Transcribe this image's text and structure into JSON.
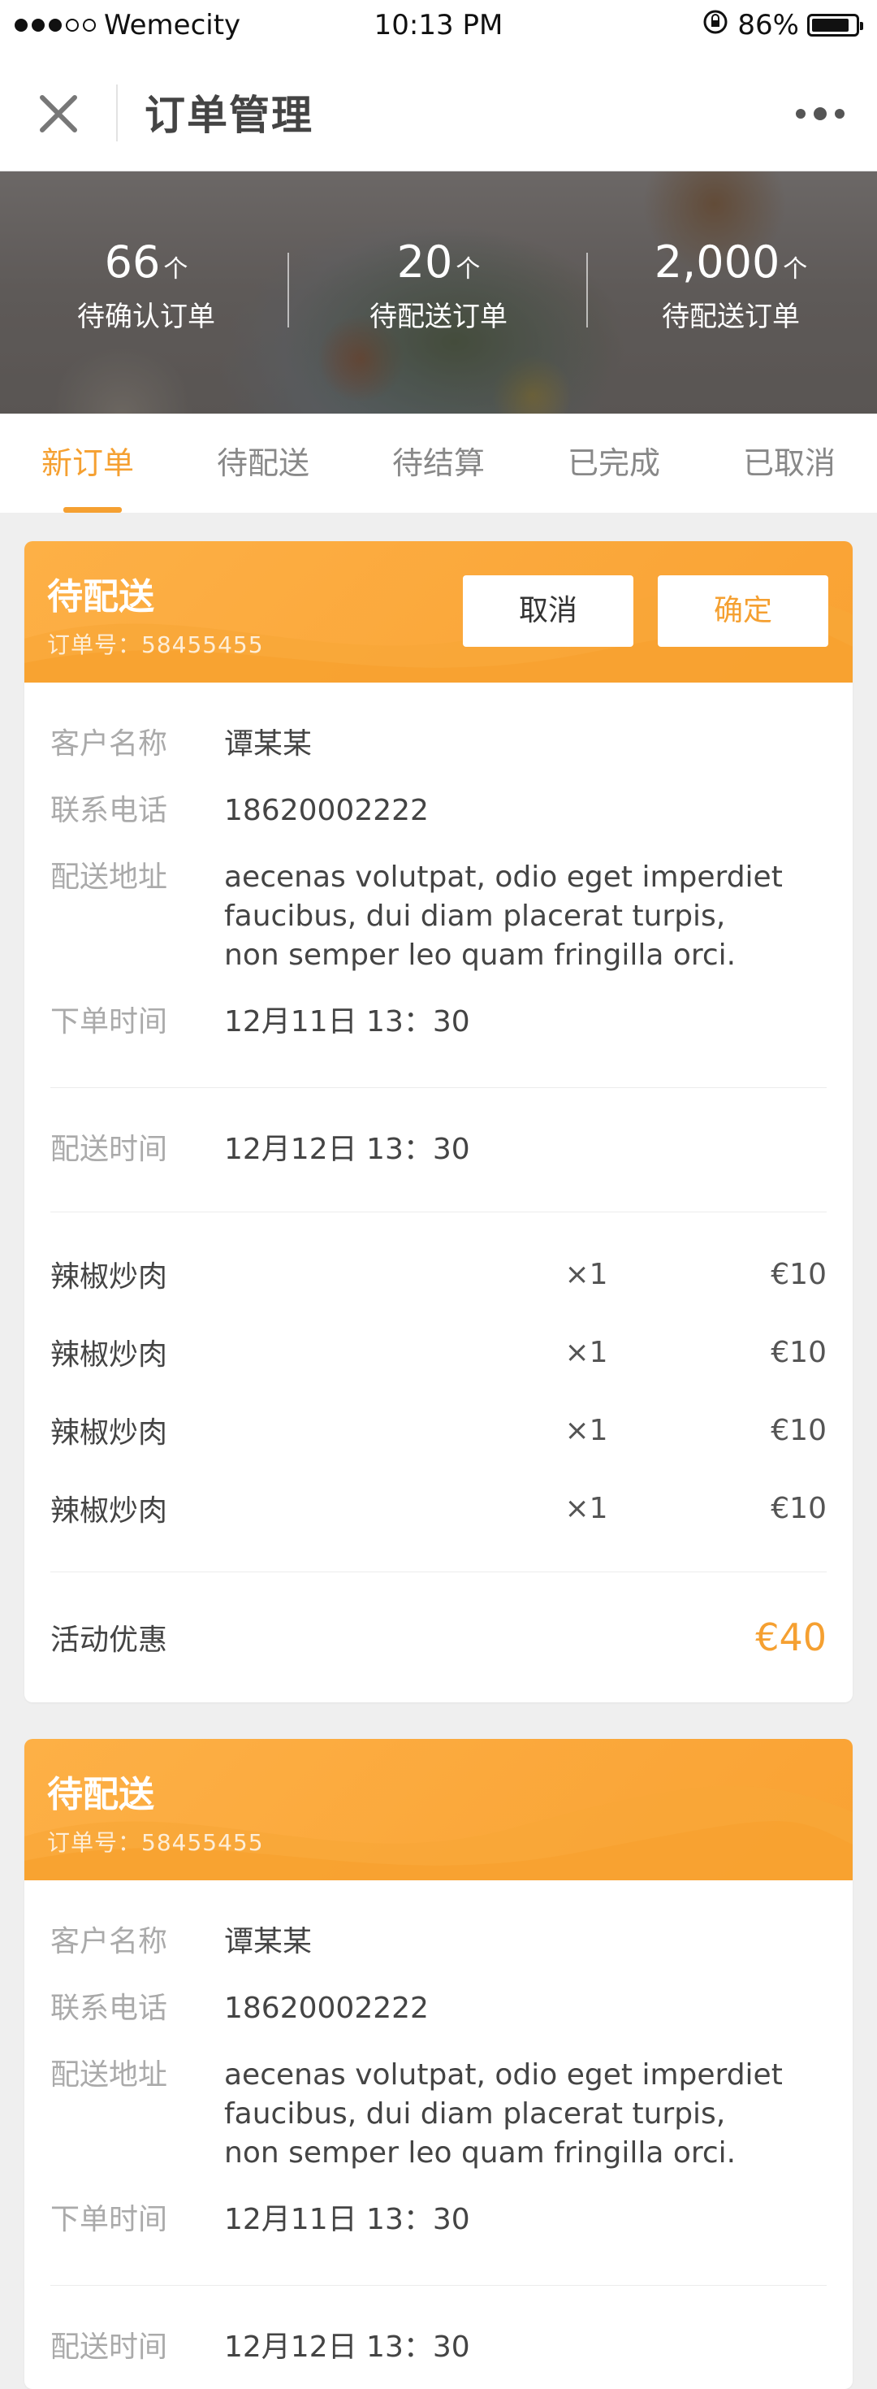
{
  "status_bar": {
    "carrier": "Wemecity",
    "time": "10:13 PM",
    "battery": "86%"
  },
  "nav": {
    "title": "订单管理"
  },
  "stats": [
    {
      "value": "66",
      "unit": "个",
      "label": "待确认订单"
    },
    {
      "value": "20",
      "unit": "个",
      "label": "待配送订单"
    },
    {
      "value": "2,000",
      "unit": "个",
      "label": "待配送订单"
    }
  ],
  "tabs": [
    {
      "label": "新订单"
    },
    {
      "label": "待配送"
    },
    {
      "label": "待结算"
    },
    {
      "label": "已完成"
    },
    {
      "label": "已取消"
    }
  ],
  "orders": [
    {
      "status": "待配送",
      "order_no": "订单号：58455455",
      "cancel_label": "取消",
      "confirm_label": "确定",
      "customer_label": "客户名称",
      "customer": "谭某某",
      "phone_label": "联系电话",
      "phone": "18620002222",
      "address_label": "配送地址",
      "address": "aecenas volutpat, odio eget imperdiet faucibus, dui diam placerat turpis, non semper leo quam fringilla orci.",
      "order_time_label": "下单时间",
      "order_time": "12月11日 13：30",
      "delivery_time_label": "配送时间",
      "delivery_time": "12月12日 13：30",
      "items": [
        {
          "name": "辣椒炒肉",
          "qty": "×1",
          "price": "€10"
        },
        {
          "name": "辣椒炒肉",
          "qty": "×1",
          "price": "€10"
        },
        {
          "name": "辣椒炒肉",
          "qty": "×1",
          "price": "€10"
        },
        {
          "name": "辣椒炒肉",
          "qty": "×1",
          "price": "€10"
        }
      ],
      "promo_label": "活动优惠",
      "promo_value": "€40"
    },
    {
      "status": "待配送",
      "order_no": "订单号：58455455",
      "customer_label": "客户名称",
      "customer": "谭某某",
      "phone_label": "联系电话",
      "phone": "18620002222",
      "address_label": "配送地址",
      "address": "aecenas volutpat, odio eget imperdiet faucibus, dui diam placerat turpis, non semper leo quam fringilla orci.",
      "order_time_label": "下单时间",
      "order_time": "12月11日 13：30",
      "delivery_time_label": "配送时间",
      "delivery_time": "12月12日 13：30"
    }
  ],
  "icons": {
    "close": "close-icon",
    "more": "more-icon",
    "lock_rotation": "lock-rotation-icon"
  },
  "colors": {
    "accent": "#f5a031",
    "card_header": "#fdb046"
  }
}
